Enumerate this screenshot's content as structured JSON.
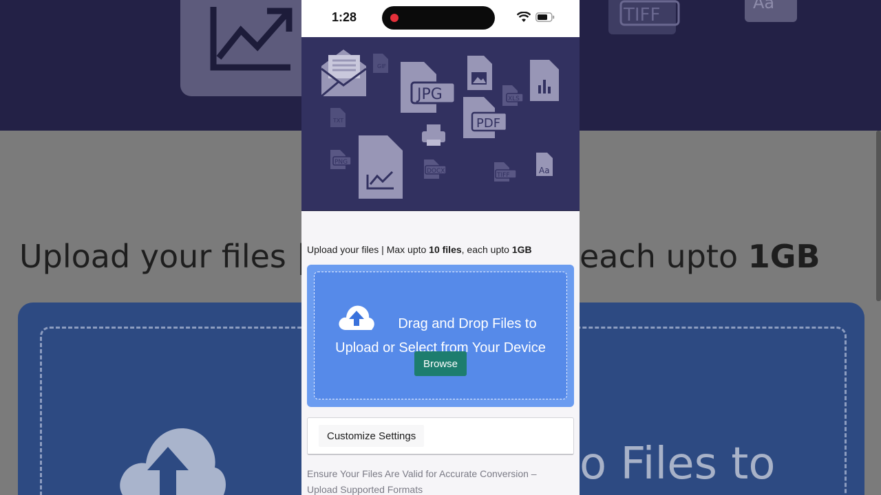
{
  "status_bar": {
    "time": "1:28"
  },
  "background": {
    "upload_text_left": "Upload your files | ",
    "upload_text_right_prefix": "each upto ",
    "upload_text_right_bold": "1GB",
    "drop_text_fragment": "o Files to",
    "tiff_label": "TIFF",
    "aa_label": "Aa"
  },
  "hero": {
    "icons": [
      "envelope-icon",
      "gif-file-icon",
      "jpg-file-icon",
      "image-file-icon",
      "chart-file-icon",
      "xls-file-icon",
      "pdf-file-icon",
      "txt-file-icon",
      "printer-icon",
      "png-file-icon",
      "line-chart-file-icon",
      "docx-file-icon",
      "tiff-file-icon",
      "font-file-icon"
    ],
    "labels": {
      "jpg": "JPG",
      "pdf": "PDF",
      "gif": "GIF",
      "xls": "XLS",
      "txt": "TXT",
      "png": "PNG",
      "docx": "DOCX",
      "tiff": "TIFF",
      "font": "Aa"
    }
  },
  "upload": {
    "intro": "Upload your files | Max upto ",
    "max_files": "10 files",
    "mid": ", each upto ",
    "max_size": "1GB"
  },
  "dropzone": {
    "line1": "Drag and Drop Files to",
    "line2": "Upload or Select from Your Device",
    "browse_label": "Browse",
    "colors": {
      "outer": "#6b9cf0",
      "inner": "#568ae9",
      "button": "#1d7d6e"
    }
  },
  "settings": {
    "label": "Customize Settings"
  },
  "note": {
    "text": "Ensure Your Files Are Valid for Accurate Conversion – Upload Supported Formats"
  }
}
